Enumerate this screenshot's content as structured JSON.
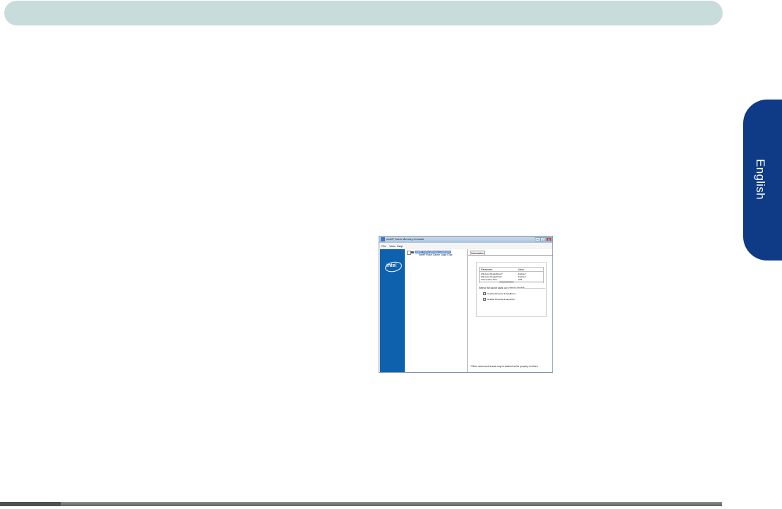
{
  "side_tab": {
    "label": "English"
  },
  "window": {
    "title": "Intel® Turbo Memory Console",
    "controls": {
      "minimize": "–",
      "maximize": "□",
      "close": "x"
    },
    "menu": [
      "File",
      "View",
      "Help"
    ],
    "logo_text": "intel",
    "tree": {
      "node1": "Intel® Turbo Memory Controller",
      "node2": "Intel® Flash Cache Logic Chip"
    },
    "tab_label": "Information",
    "table": {
      "headers": [
        "Parameter",
        "Value"
      ],
      "rows": [
        [
          "Windows ReadyBoost*",
          "Enabled"
        ],
        [
          "Windows ReadyDrive*",
          "Enabled"
        ],
        [
          "Total Cache Size",
          "1GB"
        ]
      ]
    },
    "group_label": "Select the cache uses you want to enable",
    "options": [
      {
        "label": "Enable Windows ReadyBoost",
        "checked": true
      },
      {
        "label": "Enable Windows ReadyDrive",
        "checked": true
      }
    ],
    "footnote": "*Other names and brands may be claimed as the property of others."
  }
}
